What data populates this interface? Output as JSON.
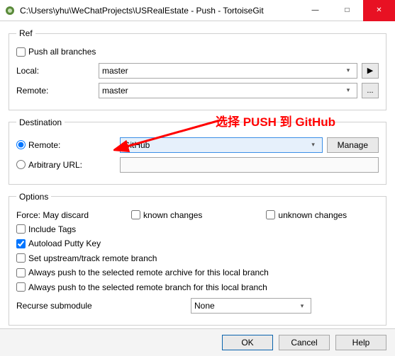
{
  "window": {
    "title": "C:\\Users\\yhu\\WeChatProjects\\USRealEstate - Push - TortoiseGit"
  },
  "ref": {
    "legend": "Ref",
    "push_all": "Push all branches",
    "local_label": "Local:",
    "local_value": "master",
    "remote_label": "Remote:",
    "remote_value": "master",
    "browse_btn": "...",
    "play_btn": "▶"
  },
  "dest": {
    "legend": "Destination",
    "remote_radio": "Remote:",
    "remote_value": "GitHub",
    "manage_btn": "Manage",
    "arbitrary_radio": "Arbitrary URL:"
  },
  "options": {
    "legend": "Options",
    "force_label": "Force: May discard",
    "known_changes": "known changes",
    "unknown_changes": "unknown changes",
    "include_tags": "Include Tags",
    "autoload_putty": "Autoload Putty Key",
    "set_upstream": "Set upstream/track remote branch",
    "always_archive": "Always push to the selected remote archive for this local branch",
    "always_branch": "Always push to the selected remote branch for this local branch",
    "recurse_label": "Recurse submodule",
    "recurse_value": "None"
  },
  "footer": {
    "ok": "OK",
    "cancel": "Cancel",
    "help": "Help"
  },
  "annotation": {
    "text": "选择 PUSH 到 GitHub"
  }
}
